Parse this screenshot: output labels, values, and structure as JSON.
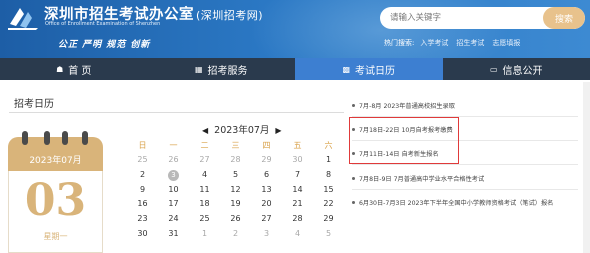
{
  "header": {
    "title": "深圳市招生考试办公室",
    "title_sub": "(深圳招考网)",
    "title_en_1": "Office of Enrollment Examination of Shenzhen",
    "slogan": "公正 严明 规范 创新",
    "search": {
      "placeholder": "请输入关键字",
      "button": "搜索"
    },
    "hot_search": {
      "label": "热门搜索:",
      "links": [
        "入学考试",
        "招生考试",
        "志愿填报"
      ]
    }
  },
  "nav": [
    {
      "label": "首 页",
      "icon": "home-icon"
    },
    {
      "label": "招考服务",
      "icon": "grid-icon"
    },
    {
      "label": "考试日历",
      "icon": "calendar-icon"
    },
    {
      "label": "信息公开",
      "icon": "doc-icon"
    }
  ],
  "panel": {
    "title": "招考日历",
    "big_calendar": {
      "month": "2023年07月",
      "day": "03",
      "weekday": "星期一"
    },
    "month_label": "2023年07月",
    "weekdays": [
      "日",
      "一",
      "二",
      "三",
      "四",
      "五",
      "六"
    ],
    "weeks": [
      [
        "25",
        "26",
        "27",
        "28",
        "29",
        "30",
        "1"
      ],
      [
        "2",
        "3",
        "4",
        "5",
        "6",
        "7",
        "8"
      ],
      [
        "9",
        "10",
        "11",
        "12",
        "13",
        "14",
        "15"
      ],
      [
        "16",
        "17",
        "18",
        "19",
        "20",
        "21",
        "22"
      ],
      [
        "23",
        "24",
        "25",
        "26",
        "27",
        "28",
        "29"
      ],
      [
        "30",
        "31",
        "1",
        "2",
        "3",
        "4",
        "5"
      ]
    ],
    "today": "3"
  },
  "news": [
    "7月-8月 2023年普通高校招生录取",
    "7月18日-22日 10月自考报考缴费",
    "7月11日-14日 自考新生报名",
    "7月8日-9日 7月普通高中学业水平合格性考试",
    "6月30日-7月3日 2023年下半年全国中小学教师资格考试（笔试）报名"
  ]
}
